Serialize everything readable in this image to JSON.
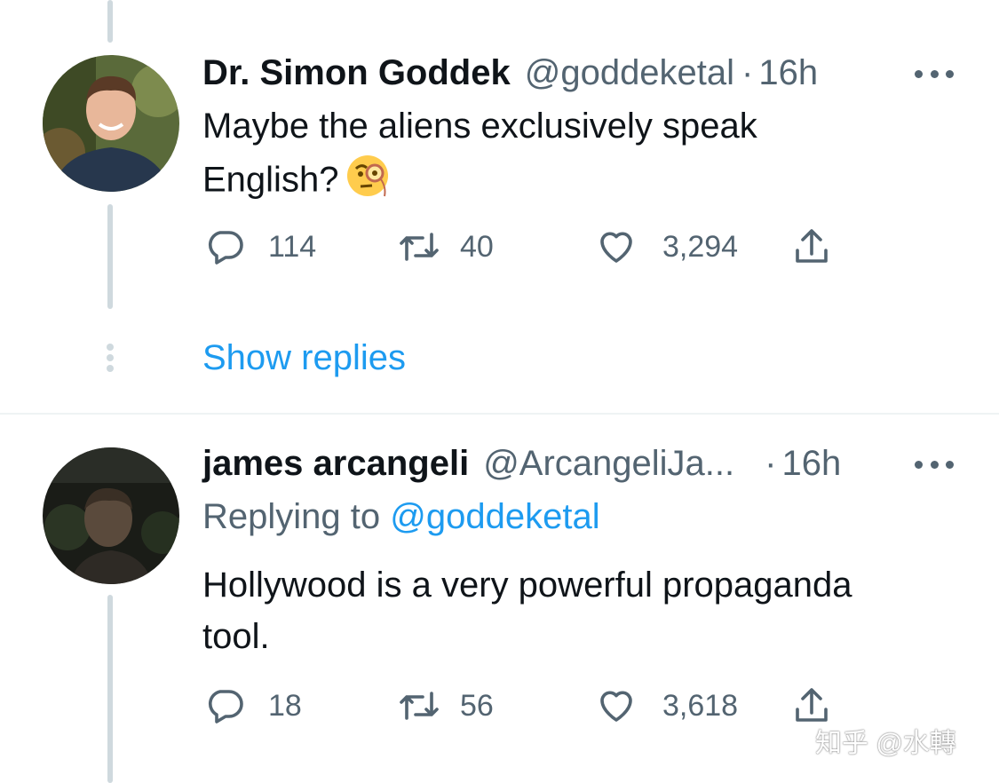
{
  "tweets": [
    {
      "name": "Dr. Simon Goddek",
      "handle": "@goddeketal",
      "separator": "·",
      "time": "16h",
      "text_line1": "Maybe the aliens exclusively speak",
      "text_line2": "English?",
      "emoji_icon": "face-with-monocle-icon",
      "replies": "114",
      "retweets": "40",
      "likes": "3,294"
    },
    {
      "name": "james arcangeli",
      "handle": "@ArcangeliJa...",
      "separator": "·",
      "time": "16h",
      "replying_prefix": "Replying to",
      "replying_handle": "@goddeketal",
      "text_line1": "Hollywood is a very powerful propaganda",
      "text_line2": "tool.",
      "replies": "18",
      "retweets": "56",
      "likes": "3,618"
    }
  ],
  "show_replies": "Show replies",
  "watermark": "知乎 @水轉",
  "colors": {
    "link": "#1d9bf0",
    "secondary": "#536471",
    "thread": "#cfd9de",
    "text": "#0f1419"
  },
  "icons": [
    "reply-icon",
    "retweet-icon",
    "like-icon",
    "share-icon",
    "more-icon"
  ]
}
